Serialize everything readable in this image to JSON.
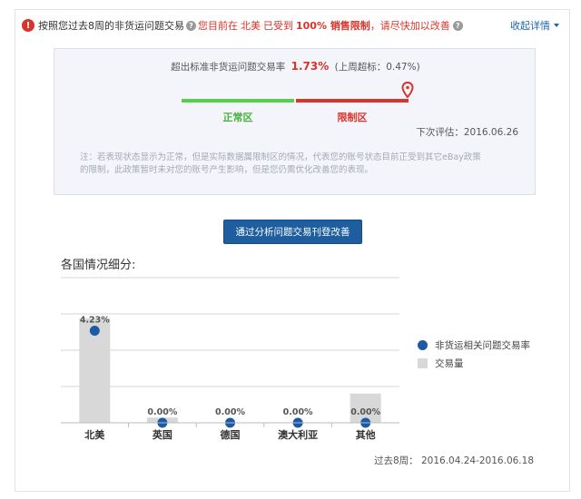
{
  "alert": {
    "text_1": "按照您过去8周的非货运问题交易",
    "text_2": "您目前在",
    "region": "北美",
    "text_3": "已受到",
    "restriction": "100% 销售限制",
    "text_4": "，请尽快加以改善",
    "collapse_label": "收起详情"
  },
  "panel": {
    "rate_label": "超出标准非货运问题交易率",
    "rate_value": "1.73%",
    "rate_prev": "(上周超标：0.47%)",
    "zone_normal": "正常区",
    "zone_restrict": "限制区",
    "next_eval": "下次评估：2016.06.26",
    "note_line1": "注：若表现状态显示为正常，但是实际数据属限制区的情况，代表您的账号状态目前正受到其它eBay政策",
    "note_line2": "的限制，此政策暂时未对您的账号产生影响，但是您仍需优化改善您的表现。"
  },
  "cta_label": "通过分析问题交易刊登改善",
  "section_title": "各国情况细分:",
  "chart_data": {
    "type": "bar",
    "categories": [
      "北美",
      "英国",
      "德国",
      "澳大利亚",
      "其他"
    ],
    "series": [
      {
        "name": "非货运相关问题交易率",
        "kind": "point",
        "labels": [
          "4.23%",
          "0.00%",
          "0.00%",
          "0.00%",
          "0.00%"
        ],
        "values": [
          4.23,
          0,
          0,
          0,
          0
        ]
      },
      {
        "name": "交易量",
        "kind": "bar",
        "values": [
          100,
          5,
          0,
          0,
          28
        ]
      }
    ],
    "grid": true,
    "legend": "right",
    "colors": {
      "point": "#1b5aa6",
      "bar": "#d8d8d8"
    }
  },
  "period": "过去8周： 2016.04.24-2016.06.18"
}
